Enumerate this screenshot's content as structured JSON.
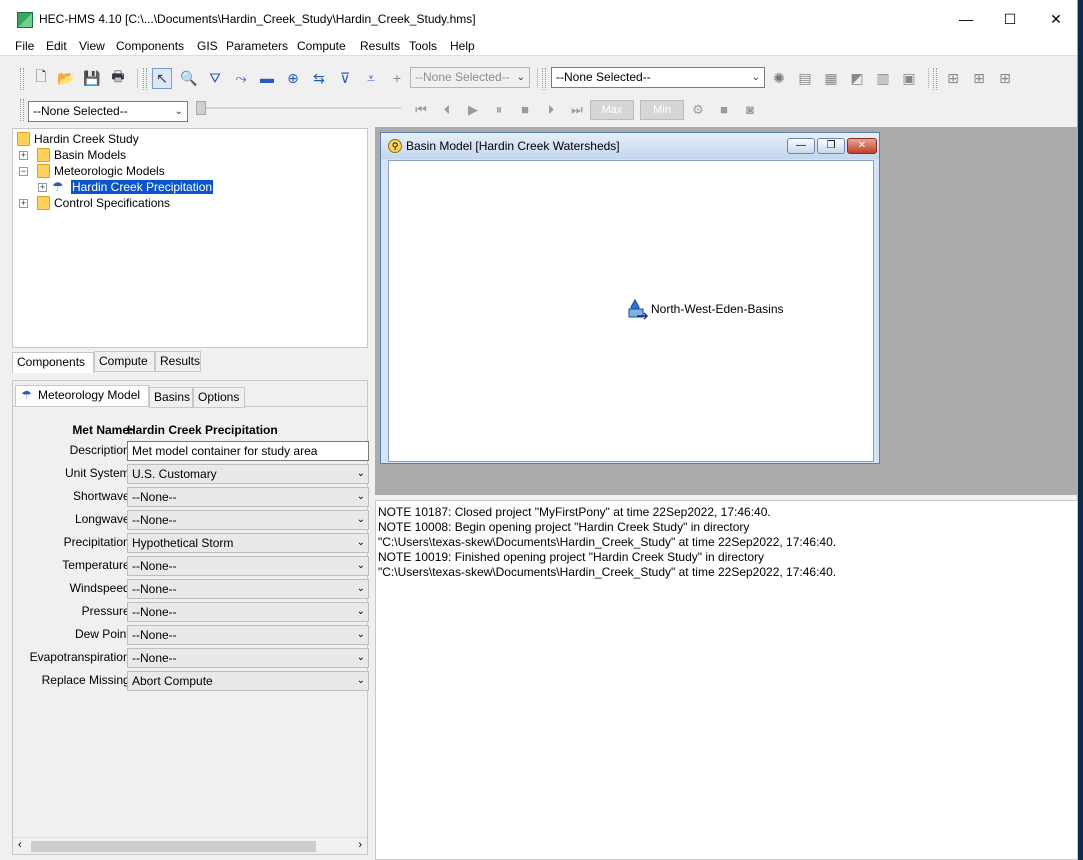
{
  "window": {
    "title": "HEC-HMS 4.10 [C:\\...\\Documents\\Hardin_Creek_Study\\Hardin_Creek_Study.hms]",
    "minimize": "—",
    "maximize": "☐",
    "close": "✕"
  },
  "menu": [
    "File",
    "Edit",
    "View",
    "Components",
    "GIS",
    "Parameters",
    "Compute",
    "Results",
    "Tools",
    "Help"
  ],
  "toolbar": {
    "selector1": "--None Selected--",
    "selector2": "--None Selected--",
    "selector3": "--None Selected--",
    "max_label": "Max",
    "min_label": "Min"
  },
  "tree": {
    "root": "Hardin Creek Study",
    "basin_models": "Basin Models",
    "met_models": "Meteorologic Models",
    "met_child": "Hardin Creek Precipitation",
    "control_specs": "Control Specifications"
  },
  "bottom_tabs": [
    "Components",
    "Compute",
    "Results"
  ],
  "prop_tabs": [
    "Meteorology Model",
    "Basins",
    "Options"
  ],
  "properties": {
    "name_label": "Met Name:",
    "name_value": "Hardin Creek Precipitation",
    "rows": [
      {
        "label": "Description:",
        "value": "Met model container for study area"
      },
      {
        "label": "Unit System:",
        "value": "U.S. Customary"
      },
      {
        "label": "Shortwave:",
        "value": "--None--"
      },
      {
        "label": "Longwave:",
        "value": "--None--"
      },
      {
        "label": "Precipitation:",
        "value": "Hypothetical Storm"
      },
      {
        "label": "Temperature:",
        "value": "--None--"
      },
      {
        "label": "Windspeed:",
        "value": "--None--"
      },
      {
        "label": "Pressure:",
        "value": "--None--"
      },
      {
        "label": "Dew Point:",
        "value": "--None--"
      },
      {
        "label": "Evapotranspiration:",
        "value": "--None--"
      },
      {
        "label": "Replace Missing:",
        "value": "Abort Compute"
      }
    ]
  },
  "basin_window": {
    "title": "Basin Model [Hardin Creek Watersheds]",
    "element_label": "North-West-Eden-Basins"
  },
  "log": [
    "NOTE 10187:  Closed project \"MyFirstPony\" at time 22Sep2022, 17:46:40.",
    "NOTE 10008:  Begin opening project \"Hardin Creek Study\" in directory",
    "\"C:\\Users\\texas-skew\\Documents\\Hardin_Creek_Study\" at time 22Sep2022, 17:46:40.",
    "NOTE 10019:  Finished opening project \"Hardin Creek Study\" in directory",
    "\"C:\\Users\\texas-skew\\Documents\\Hardin_Creek_Study\" at time 22Sep2022, 17:46:40."
  ]
}
